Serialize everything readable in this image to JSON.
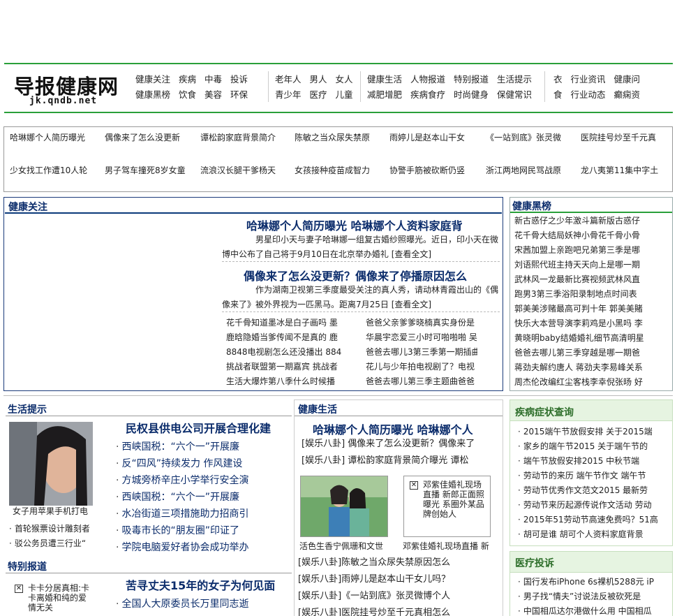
{
  "logo": {
    "cn": "导报健康网",
    "en": "jk.qndb.net"
  },
  "nav": {
    "g1": [
      [
        "健康关注",
        "疾病",
        "中毒",
        "投诉"
      ],
      [
        "健康黑榜",
        "饮食",
        "美容",
        "环保"
      ]
    ],
    "g2": [
      [
        "老年人",
        "男人",
        "女人"
      ],
      [
        "青少年",
        "医疗",
        "儿童"
      ]
    ],
    "g3": [
      [
        "健康生活",
        "人物报道",
        "特别报道",
        "生活提示"
      ],
      [
        "减肥增肥",
        "疾病食疗",
        "时尚健身",
        "保健常识"
      ]
    ],
    "g4": [
      [
        "衣",
        "行业资讯",
        "健康问"
      ],
      [
        "食",
        "行业动态",
        "癫痫资"
      ]
    ]
  },
  "hot": {
    "row1": [
      "哈琳娜个人简历曝光",
      "偶像来了怎么没更新",
      "谭松韵家庭背景简介",
      "陈敏之当众尿失禁原",
      "雨婷儿是赵本山干女",
      "《一站到底》张灵微",
      "医院挂号炒至千元真"
    ],
    "row2": [
      "少女找工作遭10人轮",
      "男子驾车撞死8岁女童",
      "流浪汉长腿干爹杨天",
      "女孩接种疫苗成智力",
      "协警手筋被砍断仍竖",
      "浙江两地网民骂战原",
      "龙八夷第11集中字土"
    ]
  },
  "focus": {
    "title": "健康关注",
    "h1": "哈琳娜个人简历曝光 哈琳娜个人资料家庭背",
    "p1": "男星印小天与妻子哈琳娜一组复古婚纱照曝光。近日，印小天在微博中公布了自己将于9月10日在北京举办婚礼 [查看全文]",
    "h2": "偶像来了怎么没更新？偶像来了停播原因怎么",
    "p2": "作为湖南卫视第三季度最受关注的真人秀，请动林青霞出山的《偶像来了》被外界视为一匹黑马。距离7月25日 [查看全文]",
    "listL": [
      "花千骨知道墨冰是白子画吗 墨",
      "鹿晗隐婚当爹传闻不是真的 鹿",
      "8848电视剧怎么还没播出 884",
      "挑战者联盟第一期嘉宾 挑战者",
      "生活大爆炸第八季什么时候播"
    ],
    "listR": [
      "爸爸父亲爹爹晓楠真实身份是",
      "华晨宇恋爱三小时可啪啪啪 吴",
      "爸爸去哪儿3第三季第一期插曲",
      "花儿与少年拍电视剧了？电视",
      "爸爸去哪儿第三季主题曲爸爸"
    ]
  },
  "blacklist": {
    "title": "健康黑榜",
    "items": [
      "新古惑仔之少年激斗篇新版古惑仔",
      "花千骨大结局妖神小骨花千骨小骨",
      "宋茜加盟上亲跑吧兄弟第三季是哪",
      "刘语熙代班主持天天向上是哪一期",
      "武林风一龙最新比赛视频武林风直",
      "跑男3第三季浴阳录制地点时间表",
      "郭美美涉赌最高可判十年 郭美美賭",
      "快乐大本营导演李莉鸡是小黑吗 李",
      "黄晓明baby结婚婚礼细节高清明星",
      "爸爸去哪儿第三季穿越是哪一期爸",
      "蒋劲夫解约唐人 蒋劲夫李易峰关系",
      "周杰伦改编红尘客栈李幸倪张旸 好"
    ]
  },
  "life_tips": {
    "title": "生活提示",
    "caption": "女子用苹果手机打电",
    "small": [
      "首轮猴票设计雕刻者",
      "驳公务员遭三行业“"
    ],
    "headline": "民权县供电公司开展合理化建",
    "items": [
      "西峡国税：“六个一”开展廉",
      "反“四风”持续发力 作风建设",
      "方城旁桥辛庄小学举行安全演",
      "西峡国税：“六个一”开展廉",
      "水冶街道三项措施助力招商引",
      "吸毒市长的“朋友圈”印证了",
      "学院电脑爱好者协会成功举办"
    ]
  },
  "special": {
    "title": "特别报道",
    "cap": "卡卡分居真相:卡卡离婚和纯的爱情无关",
    "headline": "苦寻丈夫15年的女子为何见面",
    "items": [
      "全国人大原委员长万里同志逝"
    ]
  },
  "healthy_life": {
    "title": "健康生活",
    "headline": "哈琳娜个人简历曝光 哈琳娜个人",
    "items_top": [
      "[娱乐八卦] 偶像来了怎么没更新？偶像来了",
      "[娱乐八卦] 谭松韵家庭背景简介曝光 谭松"
    ],
    "photo_caption": "活色生香宁佩珊和文世",
    "box_text": "邓紫佳婚礼现场直播 新郎正面照曝光 系圈外某品牌创始人",
    "box_caption": "邓紫佳婚礼现场直播 新",
    "items_bottom": [
      "[娱乐八卦]陈敏之当众尿失禁原因怎么",
      "[娱乐八卦]雨婷儿是赵本山干女儿吗？",
      "[娱乐八卦]《一站到底》张灵微博个人",
      "[娱乐八卦]医院挂号炒至千元真相怎么"
    ]
  },
  "symptom": {
    "title": "疾病症状查询",
    "items": [
      "2015端午节放假安排 关于2015端",
      "家乡的端午节2015 关于端午节的",
      "端午节放假安排2015 中秋节端",
      "劳动节的来历 端午节作文 端午节",
      "劳动节优秀作文范文2015 最新劳",
      "劳动节来历起源传说作文活动 劳动",
      "2015年51劳动节高速免费吗？51高",
      "胡可是谁 胡可个人资料家庭背景"
    ]
  },
  "medical": {
    "title": "医疗投诉",
    "items": [
      "国行发布iPhone 6s裸机5288元 iP",
      "男子找“情夫”讨说法反被砍死是",
      "中国相瓜达尔港做什么用 中国相瓜"
    ]
  },
  "colors": {
    "green": "#2aa03a",
    "navy": "#0b2c6b",
    "greenBg": "#e6f4e1"
  }
}
